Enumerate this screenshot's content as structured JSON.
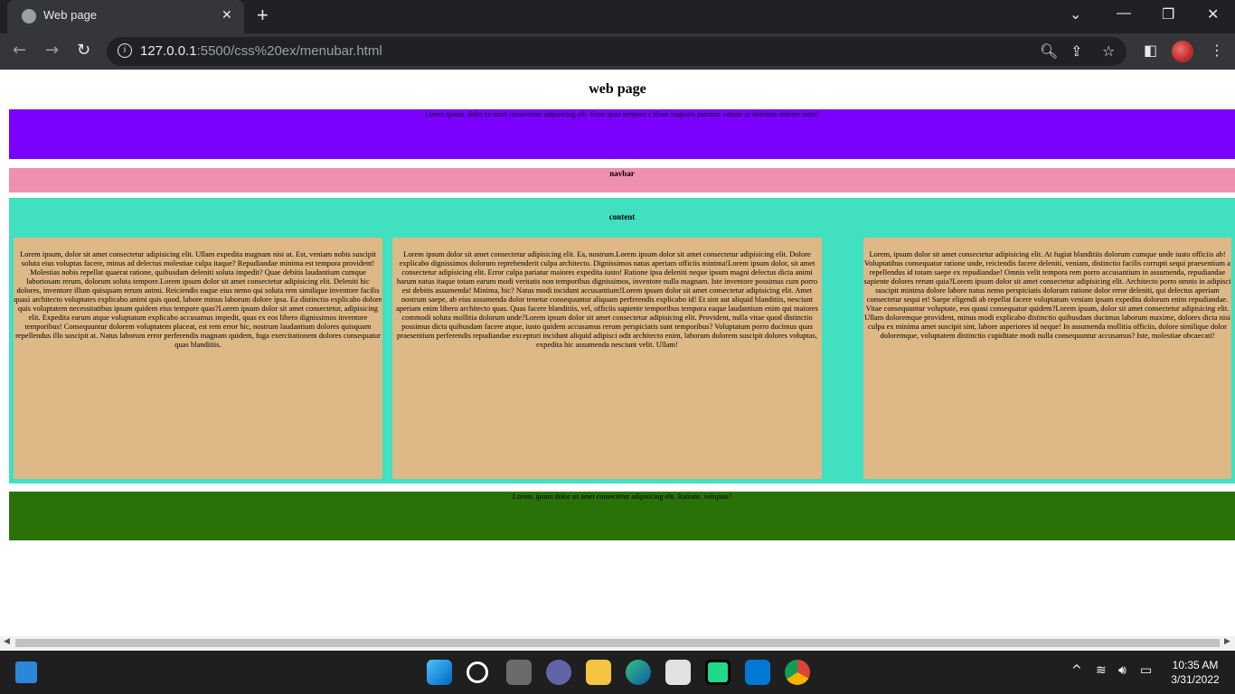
{
  "browser": {
    "tab_title": "Web page",
    "url_host": "127.0.0.1",
    "url_rest": ":5500/css%20ex/menubar.html"
  },
  "page": {
    "title": "web page",
    "header_text": "Lorem ipsum, dolor sit amet consectetur adipisicing elit. Error quae tempore a illum magnam pariatur, ratione ut dolorum dolores iusto?",
    "navbar_text": "navbar",
    "content_label": "content",
    "cards": [
      "Lorem ipsum, dolor sit amet consectetur adipisicing elit. Ullam expedita magnam nisi ut. Est, veniam nobis suscipit soluta eius voluptas facere, minus ad delectus molestiae culpa itaque? Repudiandae minima est tempora provident! Molestias nobis repellat quaerat ratione, quibusdam deleniti soluta impedit? Quae debitis laudantium cumque laboriosam rerum, dolorum soluta tempore.Lorem ipsum dolor sit amet consectetur adipisicing elit. Deleniti hic dolores, inventore illum quisquam rerum animi. Reiciendis eaque eius nemo qui soluta rem similique inventore facilis quasi architecto voluptates explicabo animi quis quod, labore minus laborum dolore ipsa. Ea distinctio explicabo dolore quis voluptatem necessitatibus ipsum quidem eius tempore quas?Lorem ipsum dolor sit amet consectetur, adipisicing elit. Expedita earum atque voluptatum explicabo accusamus impedit, quas ex eos libero dignissimos inventore temporibus! Consequuntur dolorem voluptatem placeat, est rem error hic, nostrum laudantium dolores quisquam repellendus illo suscipit at. Natus laborum error perferendis magnam quidem, fuga exercitationem dolores consequatur quas blanditiis.",
      "Lorem ipsum dolor sit amet consectetur adipisicing elit. Ea, nostrum.Lorem ipsum dolor sit amet consectetur adipisicing elit. Dolore explicabo dignissimos dolorum reprehenderit culpa architecto. Dignissimos natus aperiam officiis minima!Lorem ipsum dolor, sit amet consectetur adipisicing elit. Error culpa pariatur maiores expedita iusto! Ratione ipsa deleniti neque ipsum magni delectus dicta animi harum natus itaque totam earum modi veritatis non temporibus dignissimos, inventore nulla magnam. Iste inventore possimus cum porro est debitis assumenda! Minima, hic? Natus modi incidunt accusantium!Lorem ipsum dolor sit amet consectetur adipisicing elit. Amet nostrum saepe, ab eius assumenda dolor tenetur consequuntur aliquam perferendis explicabo id! Et sint aut aliquid blanditiis, nesciunt aperiam enim libero architecto quas. Quas facere blanditiis, vel, officiis sapiente temporibus tempora eaque laudantium enim qui maiores commodi soluta mollitia dolorum unde?Lorem ipsum dolor sit amet consectetur adipisicing elit. Provident, nulla vitae quod distinctio possimus dicta quibusdam facere atque, iusto quidem accusamus rerum perspiciatis sunt temporibus? Voluptatum porro ducimus quas praesentium perferendis repudiandae excepturi incidunt aliquid adipisci odit architecto enim, laborum dolorem suscipit dolores voluptas, expedita hic assumenda nesciunt velit. Ullam!",
      "Lorem, ipsum dolor sit amet consectetur adipisicing elit. At fugiat blanditiis dolorum cumque unde iusto officiis ab! Voluptatibus consequatur ratione unde, reiciendis facere deleniti, veniam, distinctio facilis corrupti sequi praesentium a repellendus id totam saepe ex repudiandae! Omnis velit tempora rem porro accusantium in assumenda, repudiandae sapiente dolores rerum quia?Lorem ipsum dolor sit amet consectetur adipisicing elit. Architecto porro omnis in adipisci suscipit minima dolore labore natus nemo perspiciatis dolorum ratione dolor error deleniti, qui delectus aperiam consectetur sequi et! Saepe eligendi ab repellat facere voluptatum veniam ipsam expedita dolorum enim repudiandae. Vitae consequuntur voluptate, eos quasi consequatur quidem?Lorem ipsum, dolor sit amet consectetur adipisicing elit. Ullam doloremque provident, minus modi explicabo distinctio quibusdam ducimus laborum maxime, dolores dicta nisi culpa ex minima amet suscipit sint, labore asperiores id neque! In assumenda mollitia officiis, dolore similique dolor doloremque, voluptatem distinctio cupiditate modi nulla consequuntur accusamus? Iste, molestiae obcaecati!"
    ],
    "footer_text": "Lorem, ipsum dolor sit amet consectetur adipisicing elit. Ratione, voluptas?"
  },
  "taskbar": {
    "time": "10:35 AM",
    "date": "3/31/2022"
  },
  "colors": {
    "header": "#7b00ff",
    "navbar": "#f090b0",
    "content": "#40e0c0",
    "card": "#deb887",
    "footer": "#2a7207"
  }
}
